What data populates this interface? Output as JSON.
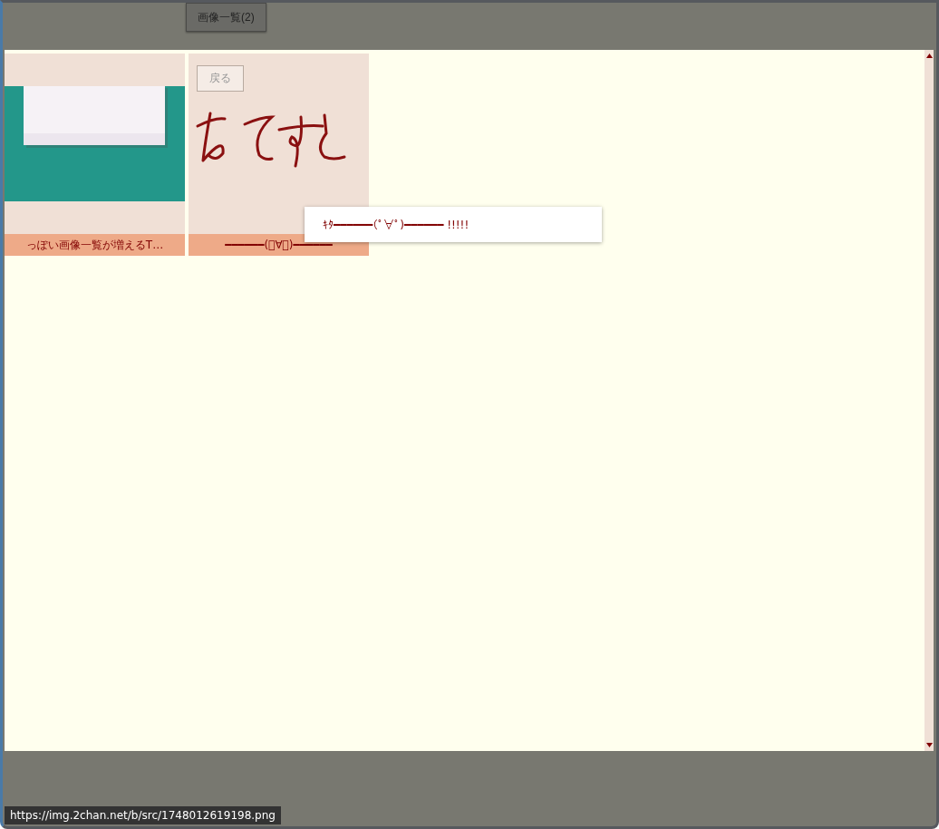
{
  "tab_button": {
    "label": "画像一覧(2)"
  },
  "gallery": {
    "items": [
      {
        "caption": "っぽい画像一覧が増えるT…"
      },
      {
        "caption": "━━━━━━(ﾟ∀ﾟ)━━━━━━",
        "back_button": "戻る"
      }
    ]
  },
  "popup": {
    "text": "ｷﾀ━━━━━━(ﾟ∀ﾟ)━━━━━━ !!!!!"
  },
  "status_bar": {
    "url": "https://img.2chan.net/b/src/1748012619198.png"
  }
}
